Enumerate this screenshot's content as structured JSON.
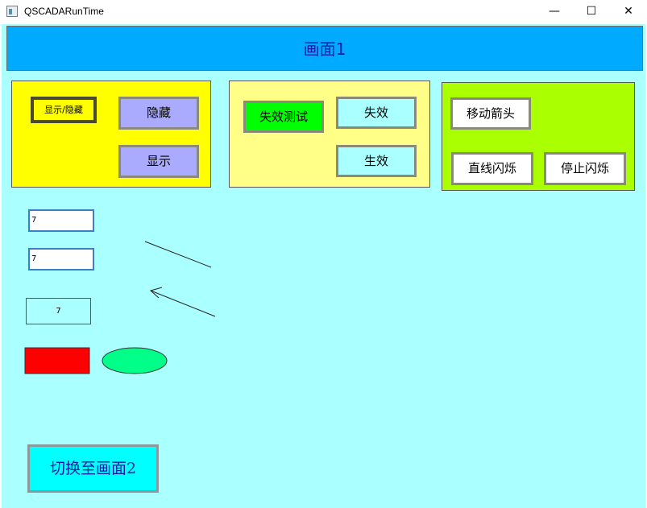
{
  "window": {
    "title": "QSCADARunTime",
    "minimize_glyph": "—",
    "maximize_glyph": "☐",
    "close_glyph": "✕"
  },
  "header": {
    "title": "画面1"
  },
  "panel_yellow": {
    "toggle_label": "显示/隐藏",
    "hide_label": "隐藏",
    "show_label": "显示"
  },
  "panel_lightyellow": {
    "test_label": "失效测试",
    "disable_label": "失效",
    "enable_label": "生效"
  },
  "panel_green": {
    "move_arrow_label": "移动箭头",
    "line_blink_label": "直线闪烁",
    "stop_blink_label": "停止闪烁"
  },
  "inputs": {
    "input1_value": "7",
    "input2_value": "7",
    "display_value": "7"
  },
  "switch_screen_label": "切换至画面2",
  "colors": {
    "header": "#00aaff",
    "client_bg": "#aaffff",
    "panel_yellow": "#ffff00",
    "panel_lightyellow": "#ffff88",
    "panel_green": "#aaff00",
    "button_lavender": "#aaaaff",
    "button_green": "#00ff00",
    "button_cyan_light": "#aaffff",
    "switch_button": "#00ffff",
    "rect_red": "#ff0000",
    "ellipse_green": "#00ff88"
  }
}
